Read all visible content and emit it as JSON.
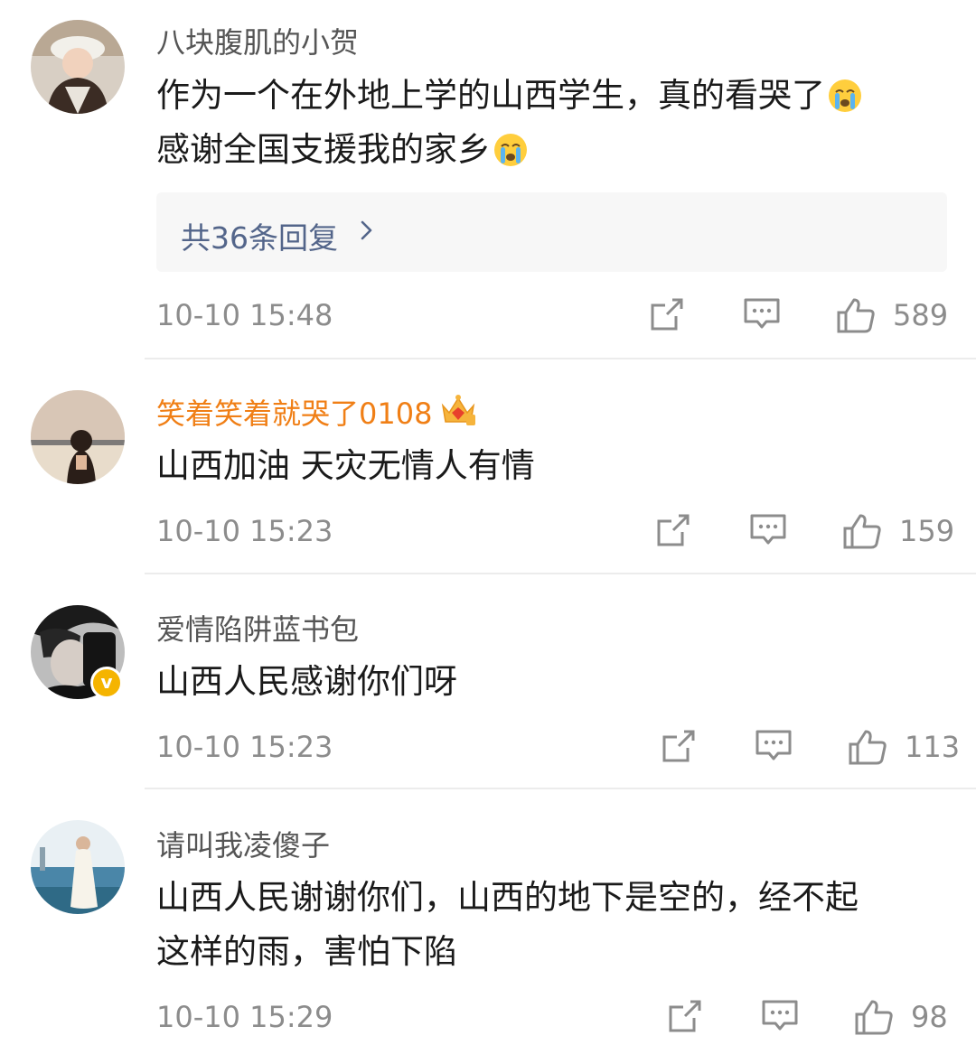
{
  "comments": [
    {
      "username": "八块腹肌的小贺",
      "lines": [
        "作为一个在外地上学的山西学生，真的看哭了",
        "感谢全国支援我的家乡"
      ],
      "emoji_names": [
        "crying-face-icon",
        "crying-face-icon"
      ],
      "reply_link": "共36条回复",
      "time": "10-10 15:48",
      "likes": "589"
    },
    {
      "username": "笑着笑着就哭了0108",
      "badge": "crown-badge-icon",
      "lines": [
        "山西加油 天灾无情人有情"
      ],
      "time": "10-10 15:23",
      "likes": "159"
    },
    {
      "username": "爱情陷阱蓝书包",
      "verified_icon": "verified-badge-icon",
      "lines": [
        "山西人民感谢你们呀"
      ],
      "time": "10-10 15:23",
      "likes": "113"
    },
    {
      "username": "请叫我凌傻子",
      "lines": [
        "山西人民谢谢你们，山西的地下是空的，经不起",
        "这样的雨，害怕下陷"
      ],
      "time": "10-10 15:29",
      "likes": "98"
    }
  ],
  "colors": {
    "text": "#1a1a1a",
    "secondary": "#8c8c8c",
    "username": "#555555",
    "vip_username": "#f07f16",
    "reply_link": "#53658a",
    "verified": "#f5b400"
  }
}
